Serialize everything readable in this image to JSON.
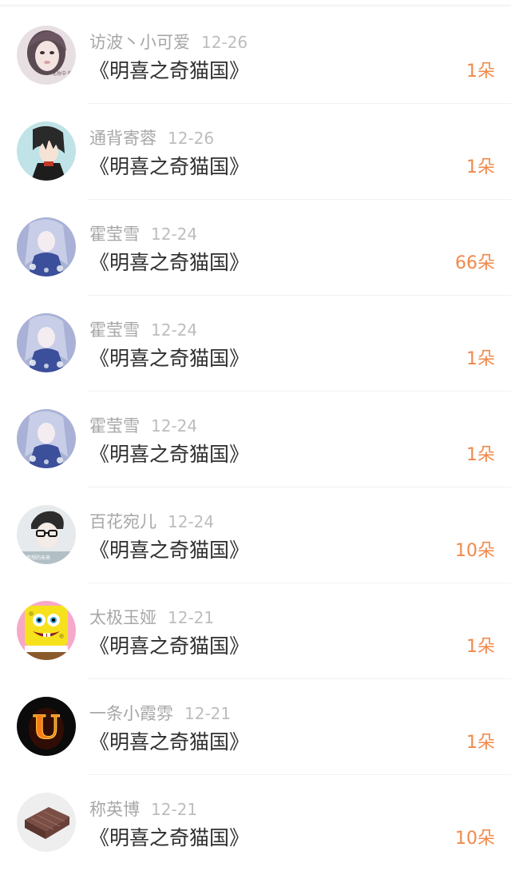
{
  "records": [
    {
      "name": "访波丶小可爱",
      "date": "12-26",
      "book": "《明喜之奇猫国》",
      "amount": "1朵",
      "avatar": "avatar-girl-photo-icon",
      "avatar_text": "化妆中 微笑"
    },
    {
      "name": "通背寄蓉",
      "date": "12-26",
      "book": "《明喜之奇猫国》",
      "amount": "1朵",
      "avatar": "avatar-anime-boy-icon"
    },
    {
      "name": "霍莹雪",
      "date": "12-24",
      "book": "《明喜之奇猫国》",
      "amount": "66朵",
      "avatar": "avatar-anime-girl-blue-icon"
    },
    {
      "name": "霍莹雪",
      "date": "12-24",
      "book": "《明喜之奇猫国》",
      "amount": "1朵",
      "avatar": "avatar-anime-girl-blue-icon"
    },
    {
      "name": "霍莹雪",
      "date": "12-24",
      "book": "《明喜之奇猫国》",
      "amount": "1朵",
      "avatar": "avatar-anime-girl-blue-icon"
    },
    {
      "name": "百花宛儿",
      "date": "12-24",
      "book": "《明喜之奇猫国》",
      "amount": "10朵",
      "avatar": "avatar-boy-glasses-icon",
      "avatar_text": "我想的未来"
    },
    {
      "name": "太极玉娅",
      "date": "12-21",
      "book": "《明喜之奇猫国》",
      "amount": "1朵",
      "avatar": "avatar-spongebob-icon"
    },
    {
      "name": "一条小霞雰",
      "date": "12-21",
      "book": "《明喜之奇猫国》",
      "amount": "1朵",
      "avatar": "avatar-fire-letter-u-icon",
      "avatar_letter": "U"
    },
    {
      "name": "称英博",
      "date": "12-21",
      "book": "《明喜之奇猫国》",
      "amount": "10朵",
      "avatar": "avatar-wood-board-icon"
    }
  ],
  "colors": {
    "name": "#a7a7a7",
    "date": "#bdbdbd",
    "book": "#2e2e2e",
    "amount": "#f0894a",
    "divider": "#f1f1f1"
  }
}
